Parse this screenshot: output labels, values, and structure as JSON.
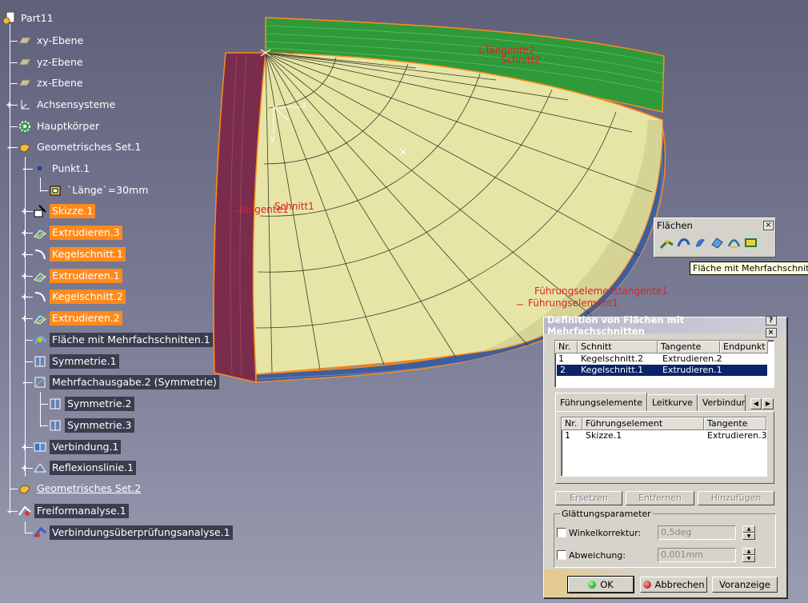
{
  "tree": {
    "root": "Part11",
    "items": [
      {
        "label": "xy-Ebene"
      },
      {
        "label": "yz-Ebene"
      },
      {
        "label": "zx-Ebene"
      },
      {
        "label": "Achsensysteme"
      },
      {
        "label": "Hauptkörper"
      },
      {
        "label": "Geometrisches Set.1"
      },
      {
        "label": "Punkt.1"
      },
      {
        "label": "`Länge`=30mm"
      },
      {
        "label": "Skizze.1"
      },
      {
        "label": "Extrudieren.3"
      },
      {
        "label": "Kegelschnitt.1"
      },
      {
        "label": "Extrudieren.1"
      },
      {
        "label": "Kegelschnitt.2"
      },
      {
        "label": "Extrudieren.2"
      },
      {
        "label": "Fläche mit Mehrfachschnitten.1"
      },
      {
        "label": "Symmetrie.1"
      },
      {
        "label": "Mehrfachausgabe.2 (Symmetrie)"
      },
      {
        "label": "Symmetrie.2"
      },
      {
        "label": "Symmetrie.3"
      },
      {
        "label": "Verbindung.1"
      },
      {
        "label": "Reflexionslinie.1"
      },
      {
        "label": "Geometrisches Set.2"
      },
      {
        "label": "Freiformanalyse.1"
      },
      {
        "label": "Verbindungsüberprüfungsanalyse.1"
      }
    ]
  },
  "viewport_labels": {
    "tangente2": "Tangente2",
    "schnitt2": "Schnitt2",
    "tangente1": "Tangente1",
    "schnitt1": "Schnitt1",
    "fuehrung_tangente": "Führungselementtangente1",
    "fuehrung": "Führungselement1",
    "axis_z": "z",
    "axis_y": "y"
  },
  "toolbar": {
    "title": "Flächen",
    "close": "×",
    "tooltip": "Fläche mit Mehrfachschnitten"
  },
  "dialog": {
    "title": "Definition von Flächen mit Mehrfachschnitten",
    "help": "?",
    "close": "×",
    "sections_table": {
      "headers": [
        "Nr.",
        "Schnitt",
        "Tangente",
        "Endpunkt"
      ],
      "rows": [
        {
          "nr": "1",
          "schnitt": "Kegelschnitt.2",
          "tangente": "Extrudieren.2",
          "endpunkt": ""
        },
        {
          "nr": "2",
          "schnitt": "Kegelschnitt.1",
          "tangente": "Extrudieren.1",
          "endpunkt": ""
        }
      ]
    },
    "tabs": [
      "Führungselemente",
      "Leitkurve",
      "Verbindung"
    ],
    "guides_table": {
      "headers": [
        "Nr.",
        "Führungselement",
        "Tangente"
      ],
      "rows": [
        {
          "nr": "1",
          "element": "Skizze.1",
          "tangente": "Extrudieren.3"
        }
      ]
    },
    "buttons": {
      "replace": "Ersetzen",
      "remove": "Entfernen",
      "add": "Hinzufügen"
    },
    "smoothing": {
      "legend": "Glättungsparameter",
      "angle_label": "Winkelkorrektur:",
      "angle_value": "0,5deg",
      "deviation_label": "Abweichung:",
      "deviation_value": "0,001mm"
    },
    "footer": {
      "ok": "OK",
      "cancel": "Abbrechen",
      "preview": "Voranzeige"
    }
  },
  "colors": {
    "highlight": "#ff8a1c",
    "surface": "#e8e8a8",
    "green_strip": "#2a9a3a",
    "red_strip": "#7a2a4a",
    "blue_strip": "#3a5a9a",
    "selection": "#0a246a"
  }
}
